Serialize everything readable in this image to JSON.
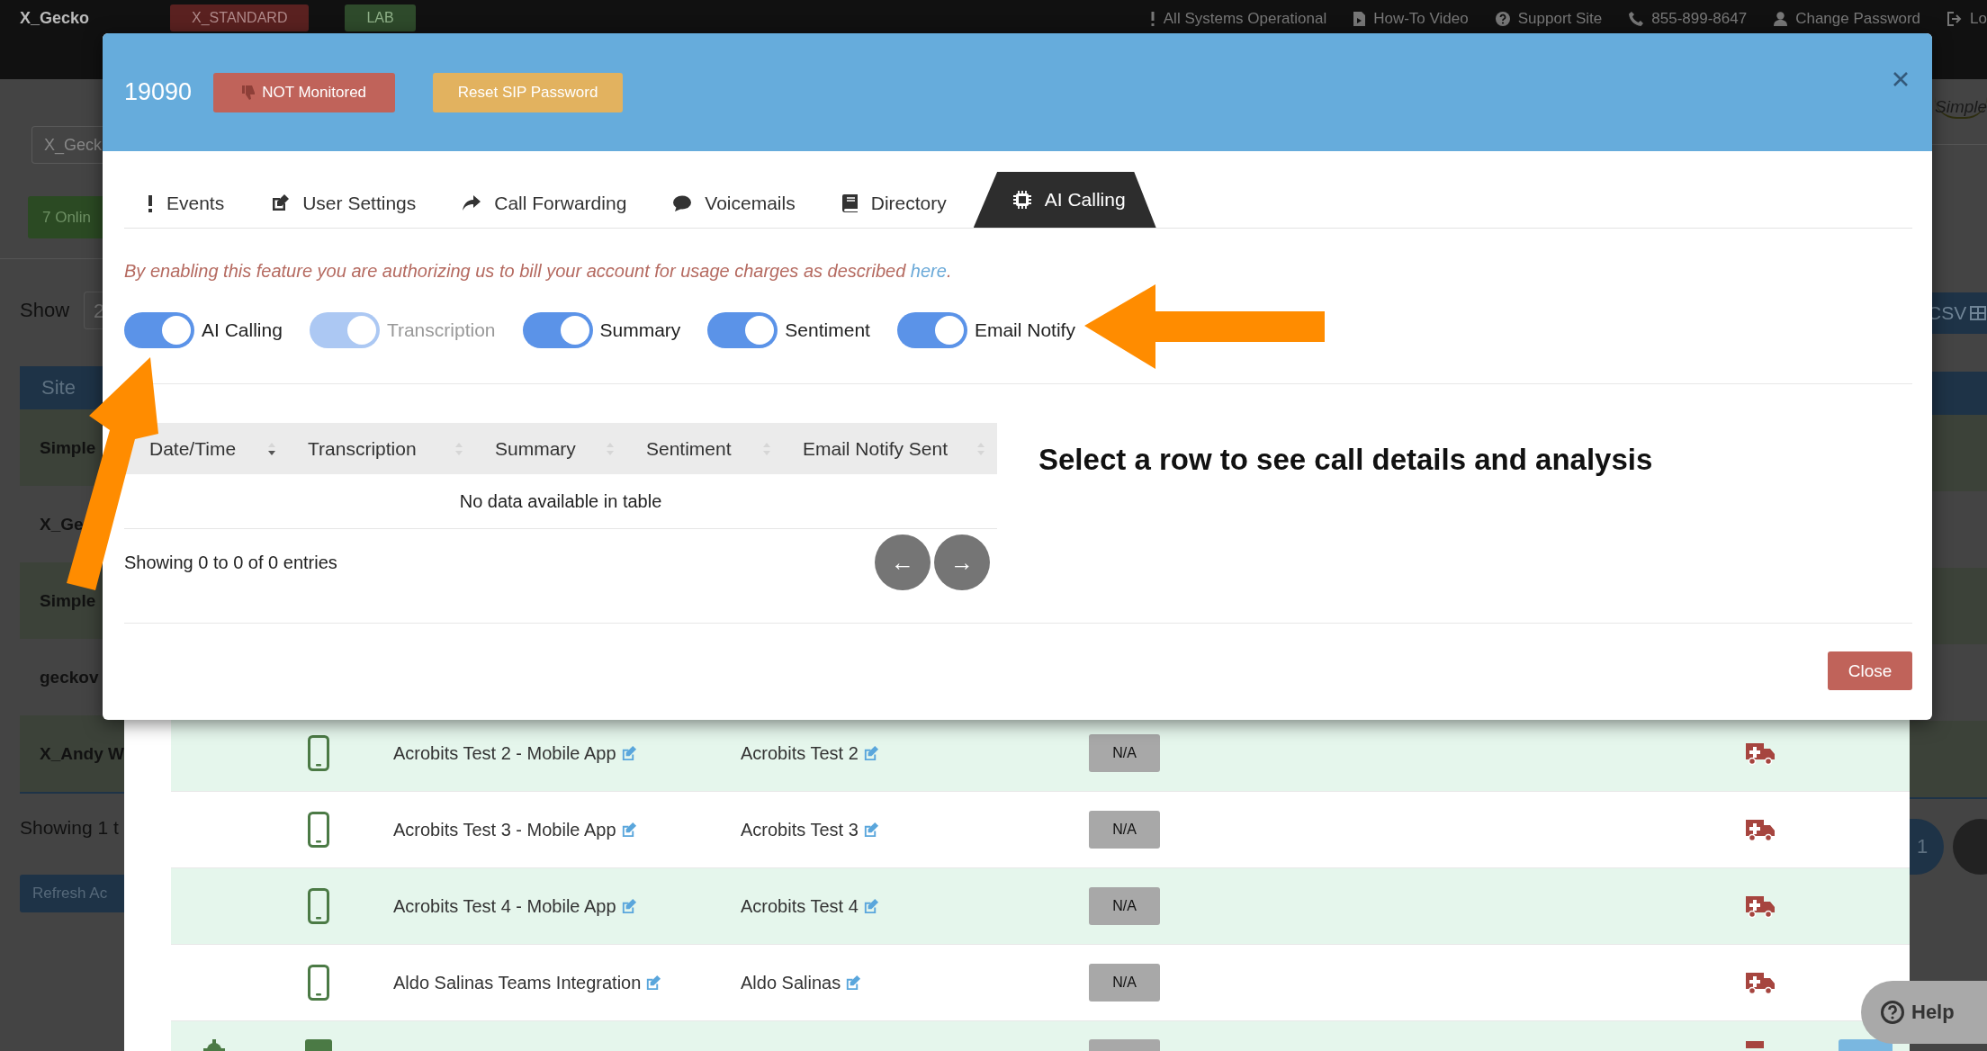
{
  "top_bar": {
    "brand": "X_Gecko",
    "badges": [
      {
        "label": "X_STANDARD",
        "color": "#5a2120"
      },
      {
        "label": "LAB",
        "color": "#2e4a2b"
      }
    ],
    "links": [
      "All Systems Operational",
      "How-To Video",
      "Support Site",
      "855-899-8647",
      "Change Password",
      "Lo"
    ]
  },
  "page": {
    "search": {
      "value": "X_Geck"
    },
    "online_button": "7 Onlin",
    "show_label": "Show",
    "show_select": "2",
    "table_heading": "Site",
    "rows": [
      "Simple",
      "X_Ge",
      "Simple",
      "geckov",
      "X_Andy W"
    ],
    "summary": "Showing 1 t",
    "refresh_button": "Refresh Ac",
    "logo": "Simple",
    "csv_button": "CSV",
    "pager": "1"
  },
  "modal": {
    "extension": "19090",
    "monitor_button": "NOT Monitored",
    "reset_button": "Reset SIP Password",
    "tabs": [
      {
        "label": "Events",
        "selected": false
      },
      {
        "label": "User Settings",
        "selected": false
      },
      {
        "label": "Call Forwarding",
        "selected": false
      },
      {
        "label": "Voicemails",
        "selected": false
      },
      {
        "label": "Directory",
        "selected": false
      },
      {
        "label": "AI Calling",
        "selected": true
      }
    ],
    "notice": {
      "text": "By enabling this feature you are authorizing us to bill your account for usage charges as described ",
      "link": "here",
      "tail": "."
    },
    "toggles": [
      {
        "label": "AI Calling",
        "on": true,
        "disabled": false
      },
      {
        "label": "Transcription",
        "on": true,
        "disabled": true
      },
      {
        "label": "Summary",
        "on": true,
        "disabled": false
      },
      {
        "label": "Sentiment",
        "on": true,
        "disabled": false
      },
      {
        "label": "Email Notify",
        "on": true,
        "disabled": false
      }
    ],
    "table": {
      "columns": [
        {
          "label": "Date/Time",
          "sorted": true
        },
        {
          "label": "Transcription",
          "sorted": false
        },
        {
          "label": "Summary",
          "sorted": false
        },
        {
          "label": "Sentiment",
          "sorted": false
        },
        {
          "label": "Email Notify Sent",
          "sorted": false
        }
      ],
      "empty_text": "No data available in table",
      "info": "Showing 0 to 0 of 0 entries",
      "prev": "←",
      "next": "→"
    },
    "detail_heading": "Select a row to see call details and analysis",
    "close_button": "Close"
  },
  "devices": [
    {
      "name": "Acrobits Test 2 - Mobile App",
      "description": "Acrobits Test 2",
      "status": "N/A"
    },
    {
      "name": "Acrobits Test 3 - Mobile App",
      "description": "Acrobits Test 3",
      "status": "N/A"
    },
    {
      "name": "Acrobits Test 4 - Mobile App",
      "description": "Acrobits Test 4",
      "status": "N/A"
    },
    {
      "name": "Aldo Salinas Teams Integration",
      "description": "Aldo Salinas",
      "status": "N/A"
    }
  ],
  "help_button": "Help"
}
